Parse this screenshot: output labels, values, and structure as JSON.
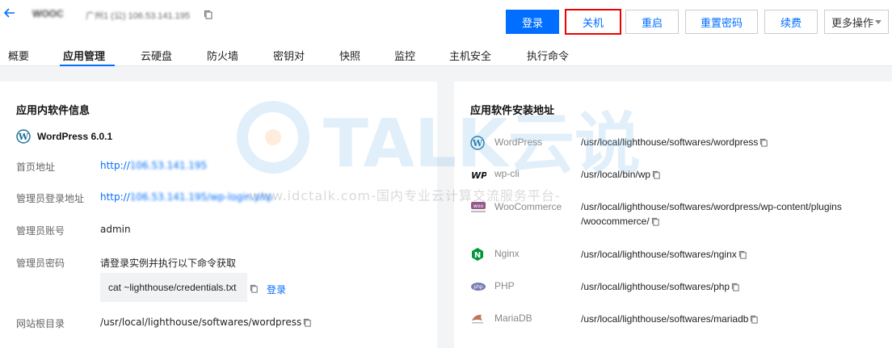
{
  "header": {
    "instance_name": "WOOC",
    "instance_meta": "广州1 (公) 106.53.141.195"
  },
  "toolbar": {
    "login_label": "登录",
    "shutdown_label": "关机",
    "restart_label": "重启",
    "reset_password_label": "重置密码",
    "renew_label": "续费",
    "more_label": "更多操作"
  },
  "tabs": [
    {
      "label": "概要"
    },
    {
      "label": "应用管理"
    },
    {
      "label": "云硬盘"
    },
    {
      "label": "防火墙"
    },
    {
      "label": "密钥对"
    },
    {
      "label": "快照"
    },
    {
      "label": "监控"
    },
    {
      "label": "主机安全"
    },
    {
      "label": "执行命令"
    }
  ],
  "left_panel": {
    "title": "应用内软件信息",
    "app_name": "WordPress 6.0.1",
    "homepage_label": "首页地址",
    "homepage_prefix": "http://",
    "homepage_hidden": "106.53.141.195",
    "admin_login_label": "管理员登录地址",
    "admin_login_prefix": "http://",
    "admin_login_hidden": "106.53.141.195/wp-login.php",
    "admin_account_label": "管理员账号",
    "admin_account_value": "admin",
    "admin_password_label": "管理员密码",
    "admin_password_hint": "请登录实例并执行以下命令获取",
    "credentials_cmd": "cat ~lighthouse/credentials.txt",
    "login_link": "登录",
    "webroot_label": "网站根目录",
    "webroot_value": "/usr/local/lighthouse/softwares/wordpress"
  },
  "right_panel": {
    "title": "应用软件安装地址",
    "software": [
      {
        "name": "WordPress",
        "path": "/usr/local/lighthouse/softwares/wordpress",
        "path2": ""
      },
      {
        "name": "wp-cli",
        "path": "/usr/local/bin/wp",
        "path2": ""
      },
      {
        "name": "WooCommerce",
        "path": "/usr/local/lighthouse/softwares/wordpress/wp-content/plugins",
        "path2": "/woocommerce/"
      },
      {
        "name": "Nginx",
        "path": "/usr/local/lighthouse/softwares/nginx",
        "path2": ""
      },
      {
        "name": "PHP",
        "path": "/usr/local/lighthouse/softwares/php",
        "path2": ""
      },
      {
        "name": "MariaDB",
        "path": "/usr/local/lighthouse/softwares/mariadb",
        "path2": ""
      }
    ]
  },
  "watermark": {
    "text": "-www.idctalk.com-国内专业云计算交流服务平台-",
    "logo_text": "TALK云说"
  },
  "colors": {
    "primary": "#006eff",
    "highlight": "#e00000",
    "nginx": "#009639",
    "woo": "#96588a",
    "php": "#777bb3"
  }
}
